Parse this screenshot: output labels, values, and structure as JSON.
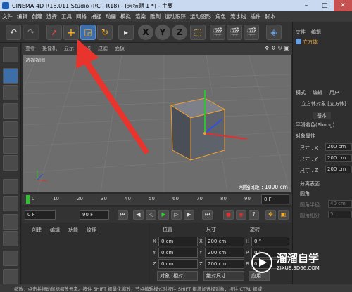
{
  "window": {
    "title": "CINEMA 4D R18.011 Studio (RC - R18) - [未标题 1 *] - 主要"
  },
  "menu": [
    "文件",
    "编辑",
    "创建",
    "选择",
    "工具",
    "网格",
    "捕捉",
    "动画",
    "模拟",
    "渲染",
    "雕刻",
    "运动跟踪",
    "运动图形",
    "角色",
    "流水线",
    "插件",
    "脚本"
  ],
  "toolbar_axes": [
    "X",
    "Y",
    "Z"
  ],
  "viewport": {
    "menu": [
      "查看",
      "摄像机",
      "显示",
      "选项",
      "过滤",
      "面板"
    ],
    "label": "透视视图",
    "grid_text": "网格间距 : 1000 cm"
  },
  "timeline": {
    "ticks": [
      "0",
      "10",
      "20",
      "30",
      "40",
      "50",
      "60",
      "70",
      "80",
      "90"
    ],
    "end_frame": "0 F"
  },
  "playback": {
    "start": "0 F",
    "end": "90 F"
  },
  "materials": {
    "menu": [
      "创建",
      "编辑",
      "功能",
      "纹理"
    ]
  },
  "coordinates": {
    "headers": [
      "位置",
      "尺寸",
      "旋转"
    ],
    "rows": [
      {
        "axis": "X",
        "pos": "0 cm",
        "size": "200 cm",
        "rot_axis": "H",
        "rot": "0 °"
      },
      {
        "axis": "Y",
        "pos": "0 cm",
        "size": "200 cm",
        "rot_axis": "P",
        "rot": "0 °"
      },
      {
        "axis": "Z",
        "pos": "0 cm",
        "size": "200 cm",
        "rot_axis": "B",
        "rot": "0 °"
      }
    ],
    "mode_select": "对象 (相对)",
    "size_select": "绝对尺寸",
    "apply_label": "应用"
  },
  "object_manager": {
    "menu": [
      "文件",
      "编辑"
    ],
    "object": "立方体"
  },
  "attributes": {
    "menu": [
      "模式",
      "编辑",
      "用户"
    ],
    "title": "立方体对象 [立方体]",
    "tab_basic": "基本",
    "tab_phong": "平滑着色(Phong)",
    "section": "对象属性",
    "fields": [
      {
        "label": "尺寸 . X",
        "value": "200 cm"
      },
      {
        "label": "尺寸 . Y",
        "value": "200 cm"
      },
      {
        "label": "尺寸 . Z",
        "value": "200 cm"
      }
    ],
    "sep_label": "分离表面",
    "fillet_label": "圆角",
    "fillet_radius": "圆角半径",
    "fillet_radius_value": "40 cm",
    "fillet_sub": "圆角细分",
    "fillet_sub_value": "5"
  },
  "status": "缩放：点击并拖动鼠标缩放元素。按住 SHIFT 键量化缩放；节点编辑模式时按住 SHIFT 键增加选择对象；按住 CTRL 键减",
  "watermark": {
    "name": "溜溜自学",
    "url": "ZIXUE.3D66.COM"
  },
  "colors": {
    "accent": "#3d6ea8",
    "arrow": "#e8342c",
    "cube_edge": "#f0a030"
  }
}
